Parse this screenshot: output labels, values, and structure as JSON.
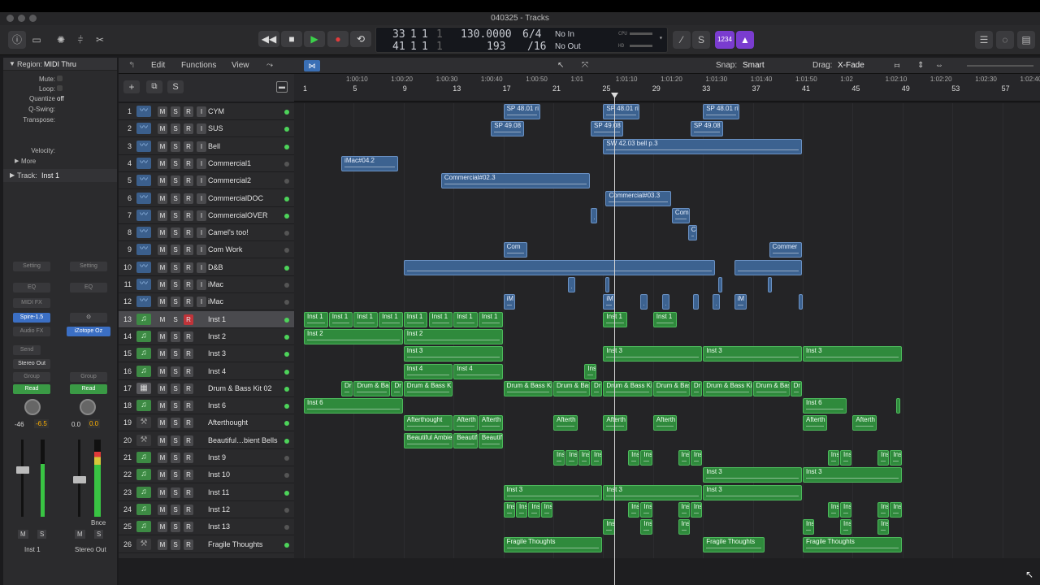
{
  "window": {
    "title": "040325 - Tracks"
  },
  "lcd": {
    "bars_top": "33",
    "beats_top": "1",
    "div_top": "1",
    "tick_top": "1",
    "bars_bot": "41",
    "beats_bot": "1",
    "div_bot": "1",
    "tick_bot": "1",
    "tempo": "130.0000",
    "tempo_sub": "193",
    "sig": "6/4",
    "sig_sub": "/16",
    "in": "No In",
    "out": "No Out",
    "cpu": "CPU",
    "hd": "HD"
  },
  "toolbar": {
    "mode_btn": "1234"
  },
  "inspector": {
    "region_label": "Region:",
    "region_name": "MIDI Thru",
    "mute": "Mute:",
    "loop": "Loop:",
    "quantize": "Quantize",
    "quantize_val": "off",
    "qswing": "Q-Swing:",
    "transpose": "Transpose:",
    "velocity": "Velocity:",
    "more": "More",
    "track_label": "Track:",
    "track_name": "Inst 1",
    "strip1": {
      "setting": "Setting",
      "eq": "EQ",
      "midifx": "MIDI FX",
      "plugin": "Spire-1.5",
      "audiofx": "Audio FX",
      "send": "Send",
      "output": "Stereo Out",
      "group": "Group",
      "auto": "Read",
      "pan": "-46",
      "vol": "-6.5",
      "m": "M",
      "s": "S",
      "name": "Inst 1"
    },
    "strip2": {
      "setting": "Setting",
      "eq": "EQ",
      "plugin": "iZotope Oz",
      "group": "Group",
      "auto": "Read",
      "pan": "0.0",
      "vol": "0.0",
      "bnce": "Bnce",
      "m": "M",
      "s": "S",
      "name": "Stereo Out"
    }
  },
  "editbar": {
    "edit": "Edit",
    "functions": "Functions",
    "view": "View",
    "snap_label": "Snap:",
    "snap": "Smart",
    "drag_label": "Drag:",
    "drag": "X-Fade"
  },
  "ruler": {
    "bars": [
      "1",
      "5",
      "9",
      "13",
      "17",
      "21",
      "25",
      "29",
      "33",
      "37",
      "41",
      "45",
      "49",
      "53",
      "57"
    ],
    "times": [
      "1:00:10",
      "1:00:20",
      "1:00:30",
      "1:00:40",
      "1:00:50",
      "1:01",
      "1:01:10",
      "1:01:20",
      "1:01:30",
      "1:01:40",
      "1:01:50",
      "1:02",
      "1:02:10",
      "1:02:20",
      "1:02:30",
      "1:02:40"
    ]
  },
  "tracks": [
    {
      "num": "1",
      "name": "CYM",
      "type": "aud",
      "active": true
    },
    {
      "num": "2",
      "name": "SUS",
      "type": "aud",
      "active": true
    },
    {
      "num": "3",
      "name": "Bell",
      "type": "aud",
      "active": true
    },
    {
      "num": "4",
      "name": "Commercial1",
      "type": "aud",
      "active": false
    },
    {
      "num": "5",
      "name": "Commercial2",
      "type": "aud",
      "active": false
    },
    {
      "num": "6",
      "name": "CommercialDOC",
      "type": "aud",
      "active": true
    },
    {
      "num": "7",
      "name": "CommercialOVER",
      "type": "aud",
      "active": true
    },
    {
      "num": "8",
      "name": "Camel's too!",
      "type": "aud",
      "active": false
    },
    {
      "num": "9",
      "name": "Com Work",
      "type": "aud",
      "active": false
    },
    {
      "num": "10",
      "name": "D&B",
      "type": "aud",
      "active": true
    },
    {
      "num": "11",
      "name": "iMac",
      "type": "aud",
      "active": false
    },
    {
      "num": "12",
      "name": "iMac",
      "type": "aud",
      "active": false
    },
    {
      "num": "13",
      "name": "Inst 1",
      "type": "sw",
      "active": true,
      "sel": true
    },
    {
      "num": "14",
      "name": "Inst 2",
      "type": "sw",
      "active": true
    },
    {
      "num": "15",
      "name": "Inst 3",
      "type": "sw",
      "active": true
    },
    {
      "num": "16",
      "name": "Inst 4",
      "type": "sw",
      "active": true
    },
    {
      "num": "17",
      "name": "Drum & Bass Kit 02",
      "type": "drm",
      "active": true
    },
    {
      "num": "18",
      "name": "Inst 6",
      "type": "sw",
      "active": true
    },
    {
      "num": "19",
      "name": "Afterthought",
      "type": "x",
      "active": true
    },
    {
      "num": "20",
      "name": "Beautiful…bient Bells",
      "type": "x",
      "active": true
    },
    {
      "num": "21",
      "name": "Inst 9",
      "type": "sw",
      "active": false
    },
    {
      "num": "22",
      "name": "Inst 10",
      "type": "sw",
      "active": false
    },
    {
      "num": "23",
      "name": "Inst 11",
      "type": "sw",
      "active": true
    },
    {
      "num": "24",
      "name": "Inst 12",
      "type": "sw",
      "active": false
    },
    {
      "num": "25",
      "name": "Inst 13",
      "type": "sw",
      "active": false
    },
    {
      "num": "26",
      "name": "Fragile Thoughts",
      "type": "x",
      "active": true
    }
  ],
  "regions": [
    {
      "t": 1,
      "s": 17,
      "e": 20,
      "l": "SP 48.01 ri",
      "k": "a"
    },
    {
      "t": 1,
      "s": 25,
      "e": 28,
      "l": "SP 48.01 ri",
      "k": "a"
    },
    {
      "t": 1,
      "s": 33,
      "e": 36,
      "l": "SP 48.01 ri",
      "k": "a"
    },
    {
      "t": 2,
      "s": 16,
      "e": 18.7,
      "l": "SP 49.08",
      "k": "a"
    },
    {
      "t": 2,
      "s": 24,
      "e": 26.7,
      "l": "SP 49.08",
      "k": "a"
    },
    {
      "t": 2,
      "s": 32,
      "e": 34.7,
      "l": "SP 49.08",
      "k": "a"
    },
    {
      "t": 3,
      "s": 25,
      "e": 41,
      "l": "SW 42.03 bell p.3",
      "k": "a"
    },
    {
      "t": 4,
      "s": 4,
      "e": 8.6,
      "l": "iMac#04.2",
      "k": "a"
    },
    {
      "t": 5,
      "s": 12,
      "e": 24,
      "l": "Commercial#02.3",
      "k": "a"
    },
    {
      "t": 6,
      "s": 25.2,
      "e": 30.5,
      "l": "Commercial#03.3",
      "k": "a"
    },
    {
      "t": 7,
      "s": 24,
      "e": 24.6,
      "l": "",
      "k": "a"
    },
    {
      "t": 7,
      "s": 30.5,
      "e": 32,
      "l": "Com",
      "k": "a"
    },
    {
      "t": 8,
      "s": 31.8,
      "e": 32.6,
      "l": "Co",
      "k": "a"
    },
    {
      "t": 9,
      "s": 17,
      "e": 19,
      "l": "Com",
      "k": "a"
    },
    {
      "t": 9,
      "s": 38.3,
      "e": 41,
      "l": "Commer",
      "k": "a"
    },
    {
      "t": 10,
      "s": 9,
      "e": 34,
      "l": "",
      "k": "a"
    },
    {
      "t": 10,
      "s": 35.5,
      "e": 41,
      "l": "",
      "k": "a"
    },
    {
      "t": 11,
      "s": 22.2,
      "e": 22.8,
      "l": "",
      "k": "a"
    },
    {
      "t": 11,
      "s": 25.2,
      "e": 25.5,
      "l": "",
      "k": "a"
    },
    {
      "t": 11,
      "s": 34.2,
      "e": 34.5,
      "l": "",
      "k": "a"
    },
    {
      "t": 11,
      "s": 38.2,
      "e": 38.5,
      "l": "",
      "k": "a"
    },
    {
      "t": 12,
      "s": 17,
      "e": 18,
      "l": "iM",
      "k": "a"
    },
    {
      "t": 12,
      "s": 25,
      "e": 26,
      "l": "iM",
      "k": "a"
    },
    {
      "t": 12,
      "s": 28,
      "e": 28.6,
      "l": "",
      "k": "a"
    },
    {
      "t": 12,
      "s": 29.7,
      "e": 30.4,
      "l": "",
      "k": "a"
    },
    {
      "t": 12,
      "s": 32.2,
      "e": 32.7,
      "l": "",
      "k": "a"
    },
    {
      "t": 12,
      "s": 33.8,
      "e": 34.4,
      "l": "",
      "k": "a"
    },
    {
      "t": 12,
      "s": 35.5,
      "e": 36.6,
      "l": "iM",
      "k": "a"
    },
    {
      "t": 12,
      "s": 40.7,
      "e": 41,
      "l": "",
      "k": "a"
    },
    {
      "t": 13,
      "s": 1,
      "e": 3,
      "l": "Inst 1",
      "k": "m"
    },
    {
      "t": 13,
      "s": 3,
      "e": 5,
      "l": "Inst 1",
      "k": "m"
    },
    {
      "t": 13,
      "s": 5,
      "e": 7,
      "l": "Inst 1",
      "k": "m"
    },
    {
      "t": 13,
      "s": 7,
      "e": 9,
      "l": "Inst 1",
      "k": "m"
    },
    {
      "t": 13,
      "s": 9,
      "e": 11,
      "l": "Inst 1",
      "k": "m"
    },
    {
      "t": 13,
      "s": 11,
      "e": 13,
      "l": "Inst 1",
      "k": "m"
    },
    {
      "t": 13,
      "s": 13,
      "e": 15,
      "l": "Inst 1",
      "k": "m"
    },
    {
      "t": 13,
      "s": 15,
      "e": 17,
      "l": "Inst 1",
      "k": "m"
    },
    {
      "t": 13,
      "s": 25,
      "e": 27,
      "l": "Inst 1",
      "k": "m"
    },
    {
      "t": 13,
      "s": 29,
      "e": 31,
      "l": "Inst 1",
      "k": "m"
    },
    {
      "t": 14,
      "s": 1,
      "e": 9,
      "l": "Inst 2",
      "k": "m"
    },
    {
      "t": 14,
      "s": 9,
      "e": 17,
      "l": "Inst 2",
      "k": "m"
    },
    {
      "t": 15,
      "s": 9,
      "e": 17,
      "l": "Inst 3",
      "k": "m"
    },
    {
      "t": 15,
      "s": 25,
      "e": 33,
      "l": "Inst 3",
      "k": "m"
    },
    {
      "t": 15,
      "s": 33,
      "e": 41,
      "l": "Inst 3",
      "k": "m"
    },
    {
      "t": 15,
      "s": 41,
      "e": 49,
      "l": "Inst 3",
      "k": "m"
    },
    {
      "t": 16,
      "s": 9,
      "e": 13,
      "l": "Inst 4",
      "k": "m"
    },
    {
      "t": 16,
      "s": 13,
      "e": 17,
      "l": "Inst 4",
      "k": "m"
    },
    {
      "t": 16,
      "s": 23.5,
      "e": 24.5,
      "l": "Ins",
      "k": "m"
    },
    {
      "t": 17,
      "s": 4,
      "e": 5,
      "l": "Dr",
      "k": "m"
    },
    {
      "t": 17,
      "s": 5,
      "e": 8,
      "l": "Drum & Bas",
      "k": "m"
    },
    {
      "t": 17,
      "s": 8,
      "e": 9,
      "l": "Dr",
      "k": "m"
    },
    {
      "t": 17,
      "s": 9,
      "e": 13,
      "l": "Drum & Bass Kit",
      "k": "m"
    },
    {
      "t": 17,
      "s": 17,
      "e": 21,
      "l": "Drum & Bass Kit",
      "k": "m"
    },
    {
      "t": 17,
      "s": 21,
      "e": 24,
      "l": "Drum & Bas",
      "k": "m"
    },
    {
      "t": 17,
      "s": 24,
      "e": 25,
      "l": "Dr",
      "k": "m"
    },
    {
      "t": 17,
      "s": 25,
      "e": 29,
      "l": "Drum & Bass Kit",
      "k": "m"
    },
    {
      "t": 17,
      "s": 29,
      "e": 32,
      "l": "Drum & Bas",
      "k": "m"
    },
    {
      "t": 17,
      "s": 32,
      "e": 33,
      "l": "Dr",
      "k": "m"
    },
    {
      "t": 17,
      "s": 33,
      "e": 37,
      "l": "Drum & Bass Kit",
      "k": "m"
    },
    {
      "t": 17,
      "s": 37,
      "e": 40,
      "l": "Drum & Bas",
      "k": "m"
    },
    {
      "t": 17,
      "s": 40,
      "e": 41,
      "l": "Dr",
      "k": "m"
    },
    {
      "t": 18,
      "s": 1,
      "e": 9,
      "l": "Inst 6",
      "k": "m"
    },
    {
      "t": 18,
      "s": 41,
      "e": 44.6,
      "l": "Inst 6",
      "k": "m"
    },
    {
      "t": 18,
      "s": 48.5,
      "e": 48.8,
      "l": "",
      "k": "m"
    },
    {
      "t": 19,
      "s": 9,
      "e": 13,
      "l": "Afterthought",
      "k": "m"
    },
    {
      "t": 19,
      "s": 13,
      "e": 15,
      "l": "Afterth",
      "k": "m"
    },
    {
      "t": 19,
      "s": 15,
      "e": 17,
      "l": "Afterth",
      "k": "m"
    },
    {
      "t": 19,
      "s": 21,
      "e": 23,
      "l": "Afterth",
      "k": "m"
    },
    {
      "t": 19,
      "s": 25,
      "e": 27,
      "l": "Afterth",
      "k": "m"
    },
    {
      "t": 19,
      "s": 29,
      "e": 31,
      "l": "Afterth",
      "k": "m"
    },
    {
      "t": 19,
      "s": 41,
      "e": 43,
      "l": "Afterth",
      "k": "m"
    },
    {
      "t": 19,
      "s": 45,
      "e": 47,
      "l": "Afterth",
      "k": "m"
    },
    {
      "t": 20,
      "s": 9,
      "e": 13,
      "l": "Beautiful Ambie",
      "k": "m"
    },
    {
      "t": 20,
      "s": 13,
      "e": 15,
      "l": "Beautif",
      "k": "m"
    },
    {
      "t": 20,
      "s": 15,
      "e": 17,
      "l": "Beautif",
      "k": "m"
    },
    {
      "t": 21,
      "s": 21,
      "e": 22,
      "l": "Ins",
      "k": "m"
    },
    {
      "t": 21,
      "s": 22,
      "e": 23,
      "l": "Ins",
      "k": "m"
    },
    {
      "t": 21,
      "s": 23,
      "e": 24,
      "l": "Ins",
      "k": "m"
    },
    {
      "t": 21,
      "s": 24,
      "e": 25,
      "l": "Ins",
      "k": "m"
    },
    {
      "t": 21,
      "s": 27,
      "e": 28,
      "l": "Ins",
      "k": "m"
    },
    {
      "t": 21,
      "s": 28,
      "e": 29,
      "l": "Ins",
      "k": "m"
    },
    {
      "t": 21,
      "s": 31,
      "e": 32,
      "l": "Ins",
      "k": "m"
    },
    {
      "t": 21,
      "s": 32,
      "e": 33,
      "l": "Ins",
      "k": "m"
    },
    {
      "t": 21,
      "s": 43,
      "e": 44,
      "l": "Ins",
      "k": "m"
    },
    {
      "t": 21,
      "s": 44,
      "e": 45,
      "l": "Ins",
      "k": "m"
    },
    {
      "t": 21,
      "s": 47,
      "e": 48,
      "l": "Ins",
      "k": "m"
    },
    {
      "t": 21,
      "s": 48,
      "e": 49,
      "l": "Ins",
      "k": "m"
    },
    {
      "t": 22,
      "s": 33,
      "e": 41,
      "l": "Inst 3",
      "k": "m"
    },
    {
      "t": 22,
      "s": 41,
      "e": 49,
      "l": "Inst 3",
      "k": "m"
    },
    {
      "t": 23,
      "s": 17,
      "e": 25,
      "l": "Inst 3",
      "k": "m"
    },
    {
      "t": 23,
      "s": 25,
      "e": 33,
      "l": "Inst 3",
      "k": "m"
    },
    {
      "t": 23,
      "s": 33,
      "e": 41,
      "l": "Inst 3",
      "k": "m"
    },
    {
      "t": 24,
      "s": 17,
      "e": 18,
      "l": "Ins",
      "k": "m"
    },
    {
      "t": 24,
      "s": 18,
      "e": 19,
      "l": "Ins",
      "k": "m"
    },
    {
      "t": 24,
      "s": 19,
      "e": 20,
      "l": "Ins",
      "k": "m"
    },
    {
      "t": 24,
      "s": 20,
      "e": 21,
      "l": "Ins",
      "k": "m"
    },
    {
      "t": 24,
      "s": 27,
      "e": 28,
      "l": "Ins",
      "k": "m"
    },
    {
      "t": 24,
      "s": 28,
      "e": 29,
      "l": "Ins",
      "k": "m"
    },
    {
      "t": 24,
      "s": 31,
      "e": 32,
      "l": "Ins",
      "k": "m"
    },
    {
      "t": 24,
      "s": 32,
      "e": 33,
      "l": "Ins",
      "k": "m"
    },
    {
      "t": 24,
      "s": 43,
      "e": 44,
      "l": "Ins",
      "k": "m"
    },
    {
      "t": 24,
      "s": 44,
      "e": 45,
      "l": "Ins",
      "k": "m"
    },
    {
      "t": 24,
      "s": 47,
      "e": 48,
      "l": "Ins",
      "k": "m"
    },
    {
      "t": 24,
      "s": 48,
      "e": 49,
      "l": "Ins",
      "k": "m"
    },
    {
      "t": 25,
      "s": 25,
      "e": 26,
      "l": "Ins",
      "k": "m"
    },
    {
      "t": 25,
      "s": 28,
      "e": 29,
      "l": "Ins",
      "k": "m"
    },
    {
      "t": 25,
      "s": 31,
      "e": 32,
      "l": "Ins",
      "k": "m"
    },
    {
      "t": 25,
      "s": 41,
      "e": 42,
      "l": "Ins",
      "k": "m"
    },
    {
      "t": 25,
      "s": 44,
      "e": 45,
      "l": "Ins",
      "k": "m"
    },
    {
      "t": 25,
      "s": 47,
      "e": 48,
      "l": "Ins",
      "k": "m"
    },
    {
      "t": 26,
      "s": 17,
      "e": 25,
      "l": "Fragile Thoughts",
      "k": "m"
    },
    {
      "t": 26,
      "s": 33,
      "e": 38,
      "l": "Fragile Thoughts",
      "k": "m"
    },
    {
      "t": 26,
      "s": 41,
      "e": 49,
      "l": "Fragile Thoughts",
      "k": "m"
    }
  ]
}
